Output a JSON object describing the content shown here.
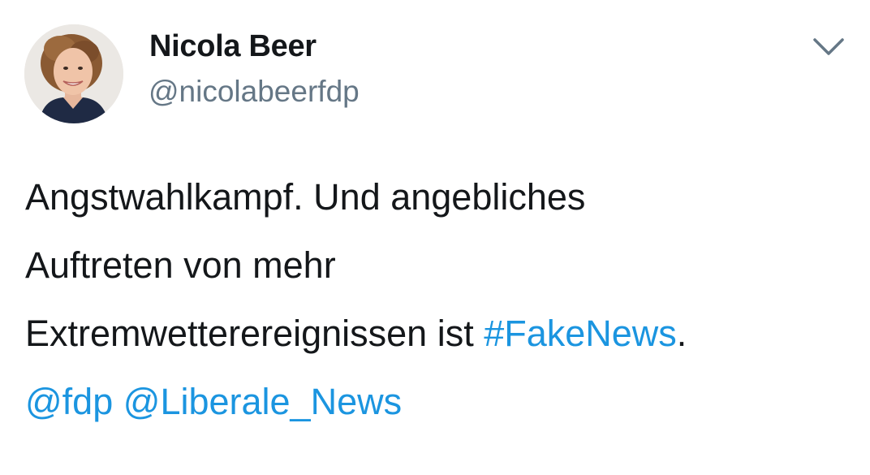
{
  "tweet": {
    "author": {
      "display_name": "Nicola Beer",
      "handle": "@nicolabeerfdp",
      "avatar_icon": "profile-photo-avatar"
    },
    "menu_icon": "chevron-down-icon",
    "text": {
      "line1": "Angstwahlkampf. Und angebliches",
      "line2": "Auftreten von mehr",
      "line3_prefix": "Extremwetterereignissen ist ",
      "hashtag": "#FakeNews",
      "line3_suffix": ".",
      "mention1": "@fdp",
      "mention2": "@Liberale_News"
    }
  },
  "colors": {
    "text": "#14171a",
    "secondary": "#657786",
    "link": "#1b95e0",
    "background": "#ffffff"
  }
}
